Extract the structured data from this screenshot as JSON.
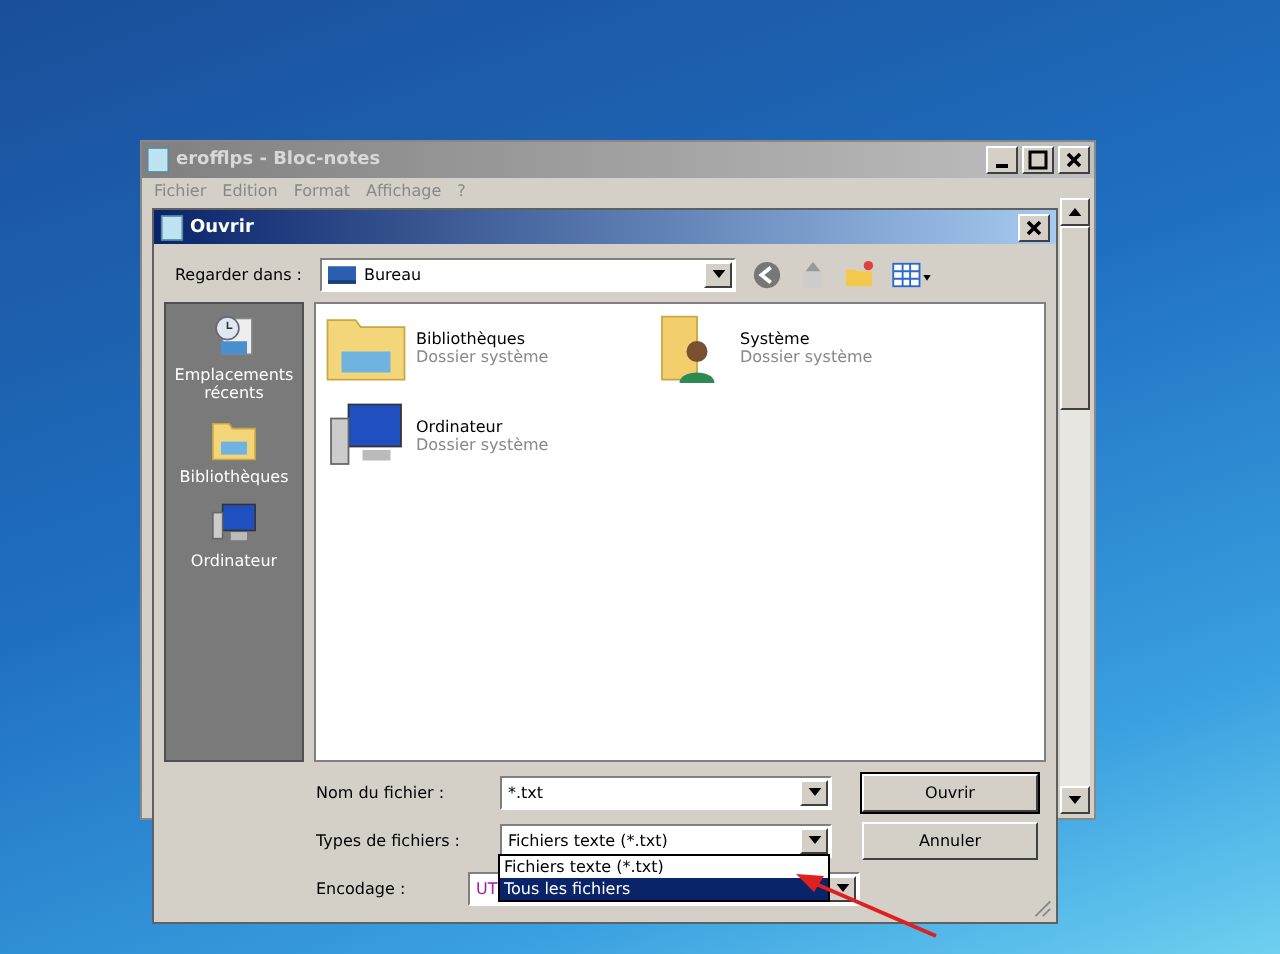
{
  "notepad": {
    "title": "erofflps - Bloc-notes",
    "menu": [
      "Fichier",
      "Edition",
      "Format",
      "Affichage",
      "?"
    ]
  },
  "dialog": {
    "title": "Ouvrir",
    "look_in": {
      "label": "Regarder dans :",
      "value": "Bureau"
    },
    "places": [
      {
        "label": "Emplacements récents",
        "kind": "recent"
      },
      {
        "label": "Bibliothèques",
        "kind": "library"
      },
      {
        "label": "Ordinateur",
        "kind": "computer"
      }
    ],
    "items": [
      {
        "name": "Bibliothèques",
        "subtitle": "Dossier système",
        "kind": "library"
      },
      {
        "name": "Système",
        "subtitle": "Dossier système",
        "kind": "user"
      },
      {
        "name": "Ordinateur",
        "subtitle": "Dossier système",
        "kind": "computer"
      }
    ],
    "file_name": {
      "label": "Nom du fichier :",
      "value": "*.txt"
    },
    "file_type": {
      "label": "Types de fichiers :",
      "value": "Fichiers texte (*.txt)"
    },
    "encoding": {
      "label": "Encodage :",
      "value": "UT"
    },
    "type_options": [
      {
        "label": "Fichiers texte (*.txt)",
        "selected": false
      },
      {
        "label": "Tous les fichiers",
        "selected": true
      }
    ],
    "buttons": [
      "Ouvrir",
      "Annuler"
    ]
  }
}
